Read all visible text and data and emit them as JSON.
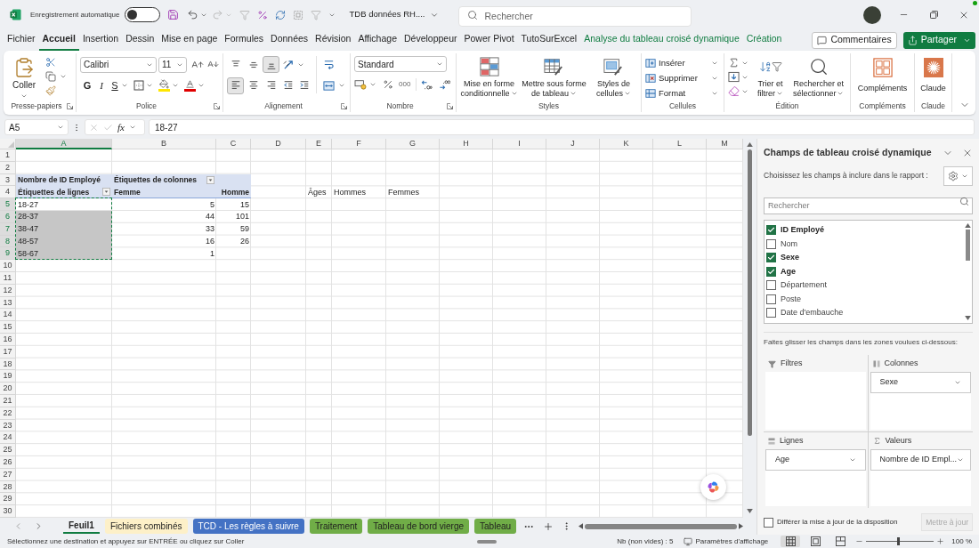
{
  "title_bar": {
    "autosave_label": "Enregistrement automatique",
    "autosave_on": false,
    "file_name": "TDB données RH....",
    "search_placeholder": "Rechercher"
  },
  "ribbon_tabs": [
    {
      "label": "Fichier",
      "selected": false,
      "kind": "standard"
    },
    {
      "label": "Accueil",
      "selected": true,
      "kind": "standard"
    },
    {
      "label": "Insertion",
      "selected": false,
      "kind": "standard"
    },
    {
      "label": "Dessin",
      "selected": false,
      "kind": "standard"
    },
    {
      "label": "Mise en page",
      "selected": false,
      "kind": "standard"
    },
    {
      "label": "Formules",
      "selected": false,
      "kind": "standard"
    },
    {
      "label": "Données",
      "selected": false,
      "kind": "standard"
    },
    {
      "label": "Révision",
      "selected": false,
      "kind": "standard"
    },
    {
      "label": "Affichage",
      "selected": false,
      "kind": "standard"
    },
    {
      "label": "Développeur",
      "selected": false,
      "kind": "standard"
    },
    {
      "label": "Power Pivot",
      "selected": false,
      "kind": "standard"
    },
    {
      "label": "TutoSurExcel",
      "selected": false,
      "kind": "standard"
    },
    {
      "label": "Analyse du tableau croisé dynamique",
      "selected": false,
      "kind": "contextual"
    },
    {
      "label": "Création",
      "selected": false,
      "kind": "contextual"
    }
  ],
  "ribbon_actions": {
    "comments": "Commentaires",
    "share": "Partager"
  },
  "ribbon": {
    "clipboard": {
      "label": "Presse-papiers",
      "paste": "Coller"
    },
    "font": {
      "label": "Police",
      "font_name": "Calibri",
      "font_size": "11",
      "bold": "G",
      "italic": "I",
      "underline": "S"
    },
    "alignment": {
      "label": "Alignement",
      "vertical": [
        {
          "kind": "top",
          "selected": false
        },
        {
          "kind": "middle",
          "selected": false
        },
        {
          "kind": "bottom",
          "selected": true
        }
      ],
      "horizontal": [
        {
          "kind": "left",
          "selected": true
        },
        {
          "kind": "center",
          "selected": false
        },
        {
          "kind": "right",
          "selected": false
        }
      ]
    },
    "number": {
      "label": "Nombre",
      "format": "Standard",
      "thousands": "000"
    },
    "styles": {
      "label": "Styles",
      "buttons": [
        {
          "kind": "conditional",
          "label": "Mise en forme conditionnelle"
        },
        {
          "kind": "table",
          "label": "Mettre sous forme de tableau"
        },
        {
          "kind": "cell_styles",
          "label": "Styles de cellules"
        }
      ]
    },
    "cells": {
      "label": "Cellules",
      "buttons": [
        {
          "kind": "insert",
          "label": "Insérer"
        },
        {
          "kind": "delete",
          "label": "Supprimer"
        },
        {
          "kind": "format",
          "label": "Format"
        }
      ]
    },
    "editing": {
      "label": "Édition",
      "buttons": [
        {
          "kind": "sort",
          "label": "Trier et filtrer"
        },
        {
          "kind": "find",
          "label": "Rechercher et sélectionner"
        }
      ]
    },
    "addins": {
      "label": "Compléments",
      "button": "Compléments"
    },
    "claude": {
      "label": "Claude",
      "button": "Claude"
    }
  },
  "formula_bar": {
    "name_box": "A5",
    "function_label": "fx",
    "formula": "18-27"
  },
  "sheet": {
    "copy_marquee": true,
    "columns": [
      {
        "label": "A",
        "selected": true
      },
      {
        "label": "B",
        "selected": false
      },
      {
        "label": "C",
        "selected": false
      },
      {
        "label": "D",
        "selected": false
      },
      {
        "label": "E",
        "selected": false
      },
      {
        "label": "F",
        "selected": false
      },
      {
        "label": "G",
        "selected": false
      },
      {
        "label": "H",
        "selected": false
      },
      {
        "label": "I",
        "selected": false
      },
      {
        "label": "J",
        "selected": false
      },
      {
        "label": "K",
        "selected": false
      },
      {
        "label": "L",
        "selected": false
      },
      {
        "label": "M",
        "selected": false
      }
    ],
    "rows": [
      {
        "label": "1",
        "selected": false
      },
      {
        "label": "2",
        "selected": false
      },
      {
        "label": "3",
        "selected": false
      },
      {
        "label": "4",
        "selected": false
      },
      {
        "label": "5",
        "selected": true
      },
      {
        "label": "6",
        "selected": true
      },
      {
        "label": "7",
        "selected": true
      },
      {
        "label": "8",
        "selected": true
      },
      {
        "label": "9",
        "selected": true
      },
      {
        "label": "10",
        "selected": false
      },
      {
        "label": "11",
        "selected": false
      },
      {
        "label": "12",
        "selected": false
      },
      {
        "label": "13",
        "selected": false
      },
      {
        "label": "14",
        "selected": false
      },
      {
        "label": "15",
        "selected": false
      },
      {
        "label": "16",
        "selected": false
      },
      {
        "label": "17",
        "selected": false
      },
      {
        "label": "18",
        "selected": false
      },
      {
        "label": "19",
        "selected": false
      },
      {
        "label": "20",
        "selected": false
      },
      {
        "label": "21",
        "selected": false
      },
      {
        "label": "22",
        "selected": false
      },
      {
        "label": "23",
        "selected": false
      },
      {
        "label": "24",
        "selected": false
      },
      {
        "label": "25",
        "selected": false
      },
      {
        "label": "26",
        "selected": false
      },
      {
        "label": "27",
        "selected": false
      },
      {
        "label": "28",
        "selected": false
      },
      {
        "label": "29",
        "selected": false
      },
      {
        "label": "30",
        "selected": false
      }
    ]
  },
  "pivot_table": {
    "value_field": "Nombre de ID Employé",
    "column_labels": "Étiquettes de colonnes",
    "row_labels": "Étiquettes de lignes",
    "column_items": [
      "Femme",
      "Homme"
    ],
    "rows": [
      {
        "label": "18-27",
        "values": [
          "5",
          "15"
        ]
      },
      {
        "label": "28-37",
        "values": [
          "44",
          "101"
        ]
      },
      {
        "label": "38-47",
        "values": [
          "33",
          "59"
        ]
      },
      {
        "label": "48-57",
        "values": [
          "16",
          "26"
        ]
      },
      {
        "label": "58-67",
        "values": [
          "1"
        ]
      }
    ]
  },
  "side_headers": [
    "Âges",
    "Hommes",
    "Femmes"
  ],
  "pivot_panel": {
    "title": "Champs de tableau croisé dynamique",
    "subtitle": "Choisissez les champs à inclure dans le rapport :",
    "search_placeholder": "Rechercher",
    "fields": [
      {
        "label": "ID Employé",
        "checked": true
      },
      {
        "label": "Nom",
        "checked": false
      },
      {
        "label": "Sexe",
        "checked": true
      },
      {
        "label": "Age",
        "checked": true
      },
      {
        "label": "Département",
        "checked": false
      },
      {
        "label": "Poste",
        "checked": false
      },
      {
        "label": "Date d'embauche",
        "checked": false
      }
    ],
    "drag_hint": "Faites glisser les champs dans les zones voulues ci-dessous:",
    "areas": [
      {
        "kind": "filters",
        "label": "Filtres"
      },
      {
        "kind": "columns",
        "label": "Colonnes",
        "items": [
          "Sexe"
        ]
      },
      {
        "kind": "rows",
        "label": "Lignes",
        "items": [
          "Age"
        ]
      },
      {
        "kind": "values",
        "label": "Valeurs",
        "items": [
          "Nombre de ID Empl..."
        ]
      }
    ],
    "defer_label": "Différer la mise à jour de la disposition",
    "defer_checked": false,
    "update_button": "Mettre à jour",
    "update_disabled": true
  },
  "sheet_tabs": [
    {
      "label": "Feuil1",
      "selected": true
    },
    {
      "label": "Fichiers combinés",
      "selected": false,
      "color": "#fdf0c8"
    },
    {
      "label": "TCD - Les règles à suivre",
      "selected": false,
      "color": "#4472c4"
    },
    {
      "label": "Traitement",
      "selected": false,
      "color": "#70ad47"
    },
    {
      "label": "Tableau de bord vierge",
      "selected": false,
      "color": "#70ad47"
    },
    {
      "label": "Tableau",
      "selected": false,
      "color": "#70ad47"
    }
  ],
  "status_bar": {
    "message": "Sélectionnez une destination et appuyez sur ENTRÉE ou cliquez sur Coller",
    "count": "Nb (non vides) : 5",
    "display_settings": "Paramètres d'affichage",
    "views": [
      {
        "kind": "normal",
        "selected": true
      },
      {
        "kind": "page_layout",
        "selected": false
      },
      {
        "kind": "page_break",
        "selected": false
      }
    ],
    "zoom": {
      "level": 0.47,
      "reading": "100 %"
    }
  }
}
